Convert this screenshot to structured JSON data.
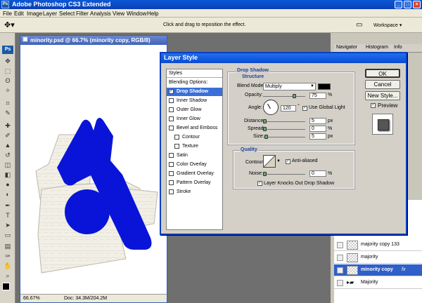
{
  "app": {
    "title": "Adobe Photoshop CS3 Extended",
    "logo": "Ps"
  },
  "menu": [
    "File",
    "Edit",
    "Image",
    "Layer",
    "Select",
    "Filter",
    "Analysis",
    "View",
    "Window",
    "Help"
  ],
  "options": {
    "hint": "Click and drag to reposition the effect.",
    "workspace": "Workspace ▾"
  },
  "document": {
    "title": "minority.psd @ 66.7% (minority copy, RGB/8)",
    "zoom": "66.67%",
    "doc_info": "Doc: 34.3M/204.2M"
  },
  "panels": {
    "tabs": [
      "Navigator",
      "Histogram",
      "Info"
    ]
  },
  "layers": [
    {
      "name": "majority copy 133"
    },
    {
      "name": "majority"
    },
    {
      "name": "minority copy",
      "fx": "fx"
    },
    {
      "name": "Majority"
    }
  ],
  "dialog": {
    "title": "Layer Style",
    "list_header": "Styles",
    "styles": [
      {
        "label": "Blending Options: Default",
        "checkbox": false,
        "checked": false,
        "indent": false,
        "selected": false
      },
      {
        "label": "Drop Shadow",
        "checkbox": true,
        "checked": true,
        "indent": false,
        "selected": true
      },
      {
        "label": "Inner Shadow",
        "checkbox": true,
        "checked": false,
        "indent": false,
        "selected": false
      },
      {
        "label": "Outer Glow",
        "checkbox": true,
        "checked": false,
        "indent": false,
        "selected": false
      },
      {
        "label": "Inner Glow",
        "checkbox": true,
        "checked": false,
        "indent": false,
        "selected": false
      },
      {
        "label": "Bevel and Emboss",
        "checkbox": true,
        "checked": false,
        "indent": false,
        "selected": false
      },
      {
        "label": "Contour",
        "checkbox": true,
        "checked": false,
        "indent": true,
        "selected": false
      },
      {
        "label": "Texture",
        "checkbox": true,
        "checked": false,
        "indent": true,
        "selected": false
      },
      {
        "label": "Satin",
        "checkbox": true,
        "checked": false,
        "indent": false,
        "selected": false
      },
      {
        "label": "Color Overlay",
        "checkbox": true,
        "checked": false,
        "indent": false,
        "selected": false
      },
      {
        "label": "Gradient Overlay",
        "checkbox": true,
        "checked": false,
        "indent": false,
        "selected": false
      },
      {
        "label": "Pattern Overlay",
        "checkbox": true,
        "checked": false,
        "indent": false,
        "selected": false
      },
      {
        "label": "Stroke",
        "checkbox": true,
        "checked": false,
        "indent": false,
        "selected": false
      }
    ],
    "drop_shadow": {
      "section": "Drop Shadow",
      "structure": "Structure",
      "blend_mode_label": "Blend Mode:",
      "blend_mode": "Multiply",
      "opacity_label": "Opacity:",
      "opacity": "75",
      "opacity_unit": "%",
      "angle_label": "Angle:",
      "angle": "120",
      "angle_unit": "°",
      "global_light": "Use Global Light",
      "distance_label": "Distance:",
      "distance": "5",
      "distance_unit": "px",
      "spread_label": "Spread:",
      "spread": "0",
      "spread_unit": "%",
      "size_label": "Size:",
      "size": "5",
      "size_unit": "px",
      "quality": "Quality",
      "contour_label": "Contour:",
      "anti_aliased": "Anti-aliased",
      "noise_label": "Noise:",
      "noise": "0",
      "noise_unit": "%",
      "knockout": "Layer Knocks Out Drop Shadow"
    },
    "buttons": {
      "ok": "OK",
      "cancel": "Cancel",
      "new_style": "New Style...",
      "preview": "Preview"
    }
  },
  "colors": {
    "accent": "#0a4ad0",
    "shape_blue": "#0a14d8"
  }
}
